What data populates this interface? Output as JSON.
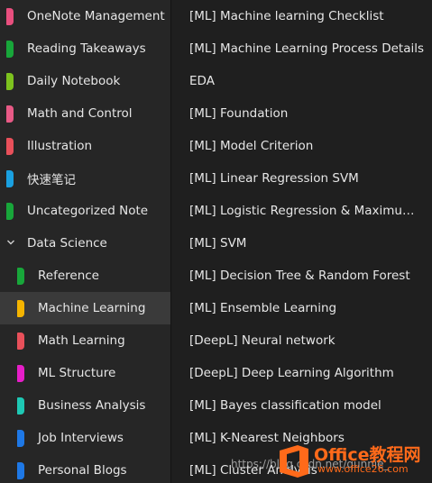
{
  "sidebar": {
    "sections": [
      {
        "label": "OneNote Management",
        "color": "#e84f7e",
        "level": 0
      },
      {
        "label": "Reading Takeaways",
        "color": "#18a63a",
        "level": 0
      },
      {
        "label": "Daily Notebook",
        "color": "#7dc21e",
        "level": 0
      },
      {
        "label": "Math and Control",
        "color": "#e85a86",
        "level": 0
      },
      {
        "label": "Illustration",
        "color": "#e8505a",
        "level": 0
      },
      {
        "label": "快速笔记",
        "color": "#1aa0e0",
        "level": 0
      },
      {
        "label": "Uncategorized Note",
        "color": "#18a63a",
        "level": 0
      }
    ],
    "group": {
      "label": "Data Science",
      "icon": "chevron-down-icon"
    },
    "subsections": [
      {
        "label": "Reference",
        "color": "#18a63a",
        "active": false
      },
      {
        "label": "Machine Learning",
        "color": "#f5b400",
        "active": true
      },
      {
        "label": "Math Learning",
        "color": "#e8505a",
        "active": false
      },
      {
        "label": "ML Structure",
        "color": "#e61ec8",
        "active": false
      },
      {
        "label": "Business Analysis",
        "color": "#1ec8b4",
        "active": false
      },
      {
        "label": "Job Interviews",
        "color": "#1e78e6",
        "active": false
      },
      {
        "label": "Personal Blogs",
        "color": "#1e78e6",
        "active": false
      }
    ]
  },
  "pages": [
    "[ML] Machine learning Checklist",
    "[ML] Machine Learning Process Details",
    "EDA",
    "[ML] Foundation",
    "[ML] Model Criterion",
    "[ML] Linear Regression SVM",
    "[ML] Logistic Regression & Maximum Entropy",
    "[ML] SVM",
    "[ML] Decision Tree & Random Forest",
    "[ML] Ensemble Learning",
    "[DeepL] Neural network",
    "[DeepL] Deep Learning Algorithm",
    "[ML] Bayes classification model",
    "[ML] K-Nearest Neighbors",
    "[ML] Cluster Analysis"
  ],
  "watermark": {
    "url": "https://blog.csdn.net/qunnie_",
    "brand": "Office教程网",
    "domain": "www.office26.com",
    "logo_color": "#ff6a1a"
  }
}
